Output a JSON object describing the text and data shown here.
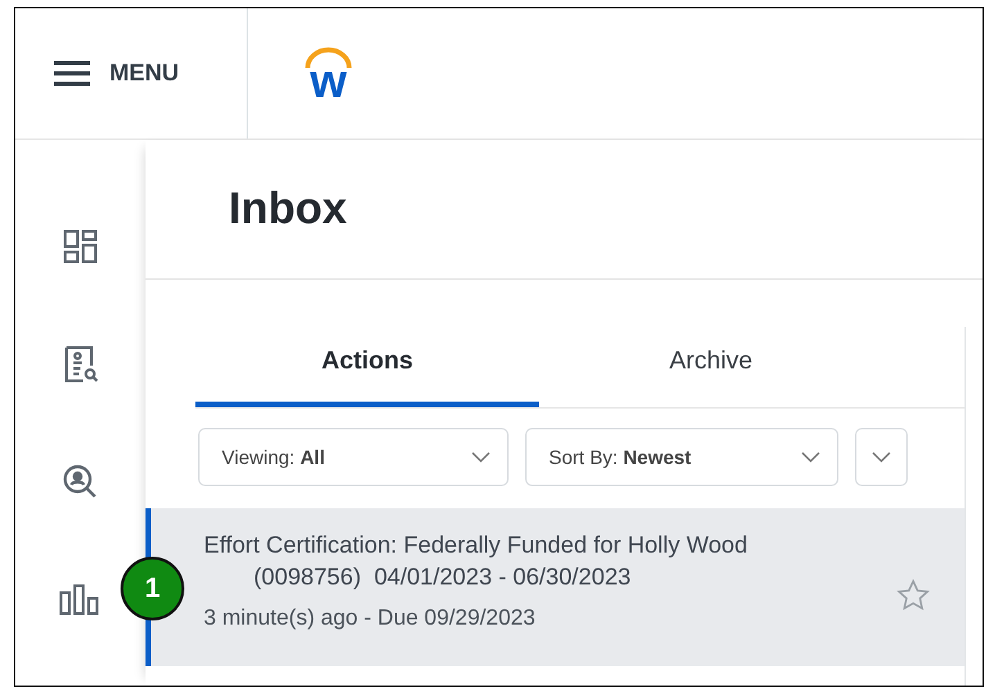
{
  "header": {
    "menu_label": "MENU",
    "logo_letter": "w"
  },
  "page": {
    "title": "Inbox"
  },
  "tabs": [
    {
      "label": "Actions",
      "selected": true
    },
    {
      "label": "Archive",
      "selected": false
    }
  ],
  "filters": [
    {
      "label": "Viewing:",
      "value": "All"
    },
    {
      "label": "Sort By:",
      "value": "Newest"
    }
  ],
  "items": [
    {
      "title": "Effort Certification: Federally Funded for Holly Wood",
      "subtitle": "(0098756)  04/01/2023 - 06/30/2023",
      "meta": "3 minute(s) ago - Due 09/29/2023",
      "selected": true,
      "starred": false
    }
  ],
  "callout": {
    "number": "1"
  }
}
